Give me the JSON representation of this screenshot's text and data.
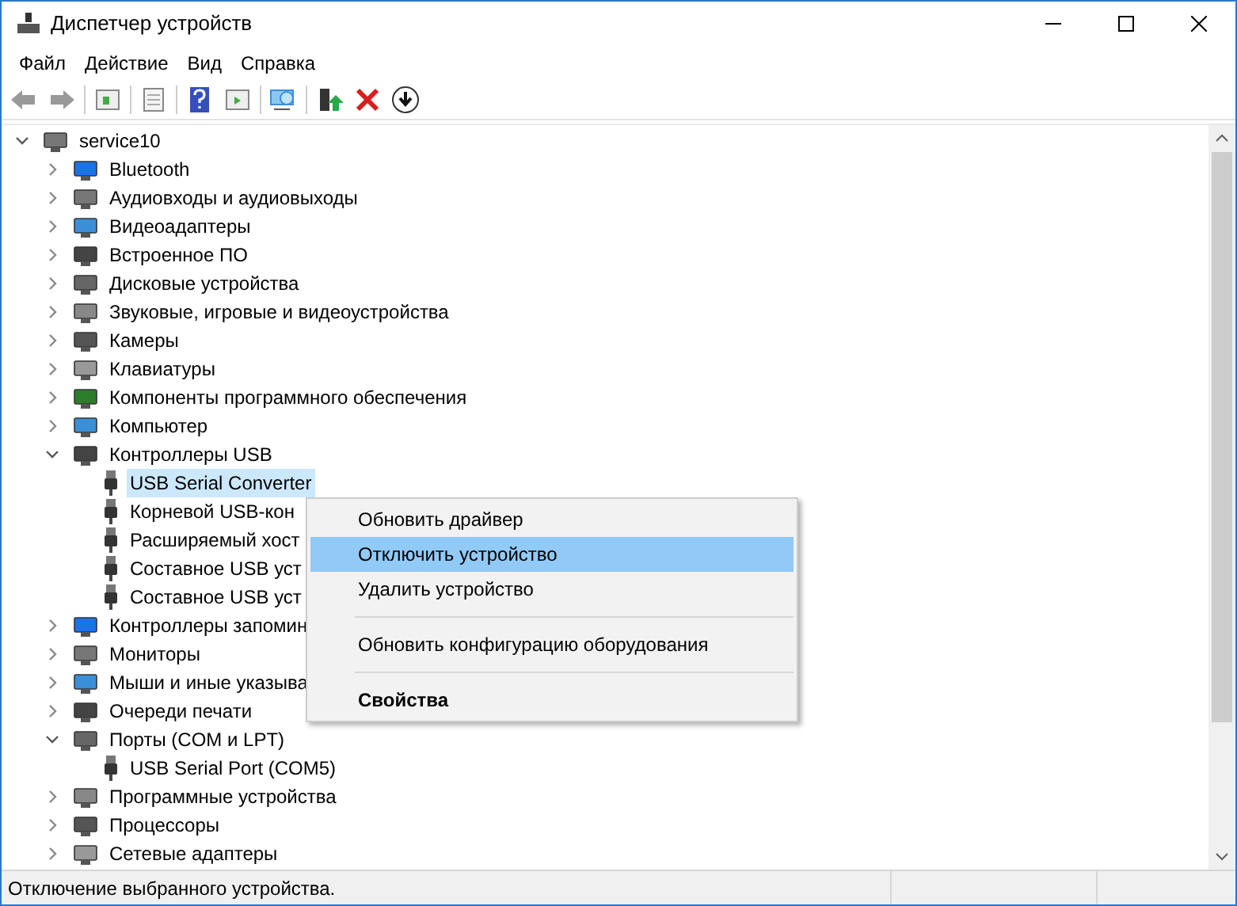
{
  "window": {
    "title": "Диспетчер устройств"
  },
  "menu_bar": [
    "Файл",
    "Действие",
    "Вид",
    "Справка"
  ],
  "tree": {
    "label": "service10",
    "expanded": true,
    "selected": false,
    "children": [
      {
        "label": "Bluetooth",
        "expanded": false,
        "selected": false
      },
      {
        "label": "Аудиовходы и аудиовыходы",
        "expanded": false,
        "selected": false
      },
      {
        "label": "Видеоадаптеры",
        "expanded": false,
        "selected": false
      },
      {
        "label": "Встроенное ПО",
        "expanded": false,
        "selected": false
      },
      {
        "label": "Дисковые устройства",
        "expanded": false,
        "selected": false
      },
      {
        "label": "Звуковые, игровые и видеоустройства",
        "expanded": false,
        "selected": false
      },
      {
        "label": "Камеры",
        "expanded": false,
        "selected": false
      },
      {
        "label": "Клавиатуры",
        "expanded": false,
        "selected": false
      },
      {
        "label": "Компоненты программного обеспечения",
        "expanded": false,
        "selected": false
      },
      {
        "label": "Компьютер",
        "expanded": false,
        "selected": false
      },
      {
        "label": "Контроллеры USB",
        "expanded": true,
        "selected": false,
        "children": [
          {
            "label": "USB Serial Converter",
            "selected": true
          },
          {
            "label": "Корневой USB-кон",
            "selected": false
          },
          {
            "label": "Расширяемый хост",
            "selected": false
          },
          {
            "label": "Составное USB уст",
            "selected": false
          },
          {
            "label": "Составное USB уст",
            "selected": false
          }
        ]
      },
      {
        "label": "Контроллеры запомин",
        "expanded": false,
        "selected": false
      },
      {
        "label": "Мониторы",
        "expanded": false,
        "selected": false
      },
      {
        "label": "Мыши и иные указыва",
        "expanded": false,
        "selected": false
      },
      {
        "label": "Очереди печати",
        "expanded": false,
        "selected": false
      },
      {
        "label": "Порты (COM и LPT)",
        "expanded": true,
        "selected": false,
        "children": [
          {
            "label": "USB Serial Port (COM5)",
            "selected": false
          }
        ]
      },
      {
        "label": "Программные устройства",
        "expanded": false,
        "selected": false
      },
      {
        "label": "Процессоры",
        "expanded": false,
        "selected": false
      },
      {
        "label": "Сетевые адаптеры",
        "expanded": false,
        "selected": false
      }
    ]
  },
  "context_menu": [
    {
      "kind": "item",
      "label": "Обновить драйвер",
      "selected": false,
      "default": false
    },
    {
      "kind": "item",
      "label": "Отключить устройство",
      "selected": true,
      "default": false
    },
    {
      "kind": "item",
      "label": "Удалить устройство",
      "selected": false,
      "default": false
    },
    {
      "kind": "separator"
    },
    {
      "kind": "item",
      "label": "Обновить конфигурацию оборудования",
      "selected": false,
      "default": false
    },
    {
      "kind": "separator"
    },
    {
      "kind": "item",
      "label": "Свойства",
      "selected": false,
      "default": true
    }
  ],
  "status_bar": "Отключение выбранного устройства."
}
